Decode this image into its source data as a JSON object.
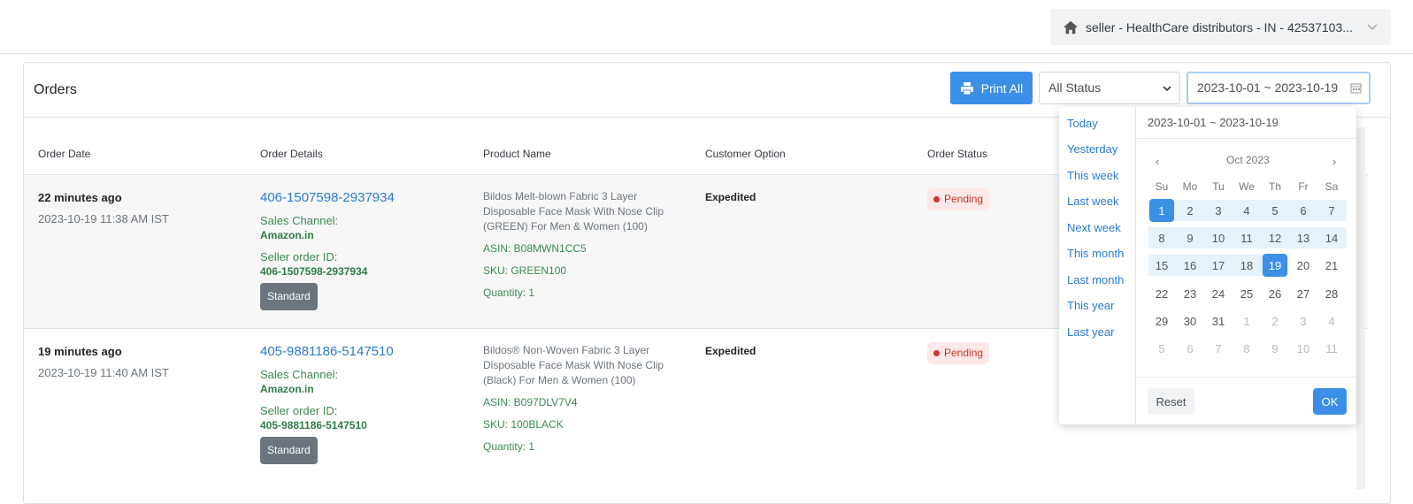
{
  "account": {
    "label": "seller - HealthCare distributors - IN - 42537103..."
  },
  "card": {
    "title": "Orders"
  },
  "toolbar": {
    "print_label": "Print All",
    "status_value": "All Status",
    "date_value": "2023-10-01 ~ 2023-10-19"
  },
  "columns": [
    "Order Date",
    "Order Details",
    "Product Name",
    "Customer Option",
    "Order Status"
  ],
  "orders": [
    {
      "relative_time": "22 minutes ago",
      "absolute_time": "2023-10-19 11:38 AM IST",
      "order_id": "406-1507598-2937934",
      "sales_channel_label": "Sales Channel:",
      "sales_channel": "Amazon.in",
      "seller_order_label": "Seller order ID:",
      "seller_order_id": "406-1507598-2937934",
      "shipping_badge": "Standard",
      "product_name": "Bildos Melt-blown Fabric 3 Layer Disposable Face Mask With Nose Clip (GREEN) For Men & Women (100)",
      "asin": "ASIN: B08MWN1CC5",
      "sku": "SKU: GREEN100",
      "quantity": "Quantity: 1",
      "customer_option": "Expedited",
      "status": "Pending"
    },
    {
      "relative_time": "19 minutes ago",
      "absolute_time": "2023-10-19 11:40 AM IST",
      "order_id": "405-9881186-5147510",
      "sales_channel_label": "Sales Channel:",
      "sales_channel": "Amazon.in",
      "seller_order_label": "Seller order ID:",
      "seller_order_id": "405-9881186-5147510",
      "shipping_badge": "Standard",
      "product_name": "Bildos® Non-Woven Fabric 3 Layer Disposable Face Mask With Nose Clip (Black) For Men & Women (100)",
      "asin": "ASIN: B097DLV7V4",
      "sku": "SKU: 100BLACK",
      "quantity": "Quantity: 1",
      "customer_option": "Expedited",
      "status": "Pending"
    }
  ],
  "picker": {
    "ranges": [
      "Today",
      "Yesterday",
      "This week",
      "Last week",
      "Next week",
      "This month",
      "Last month",
      "This year",
      "Last year"
    ],
    "header_value": "2023-10-01 ~ 2023-10-19",
    "month_title": "Oct 2023",
    "prev": "‹",
    "next": "›",
    "weekdays": [
      "Su",
      "Mo",
      "Tu",
      "We",
      "Th",
      "Fr",
      "Sa"
    ],
    "weeks": [
      [
        "1",
        "2",
        "3",
        "4",
        "5",
        "6",
        "7"
      ],
      [
        "8",
        "9",
        "10",
        "11",
        "12",
        "13",
        "14"
      ],
      [
        "15",
        "16",
        "17",
        "18",
        "19",
        "20",
        "21"
      ],
      [
        "22",
        "23",
        "24",
        "25",
        "26",
        "27",
        "28"
      ],
      [
        "29",
        "30",
        "31",
        "1",
        "2",
        "3",
        "4"
      ],
      [
        "5",
        "6",
        "7",
        "8",
        "9",
        "10",
        "11"
      ]
    ],
    "reset_label": "Reset",
    "ok_label": "OK"
  },
  "colors": {
    "accent": "#3b8fe6",
    "link": "#2a7bd4",
    "green": "#3c8b4f",
    "pending_bg": "#fde7e7"
  }
}
